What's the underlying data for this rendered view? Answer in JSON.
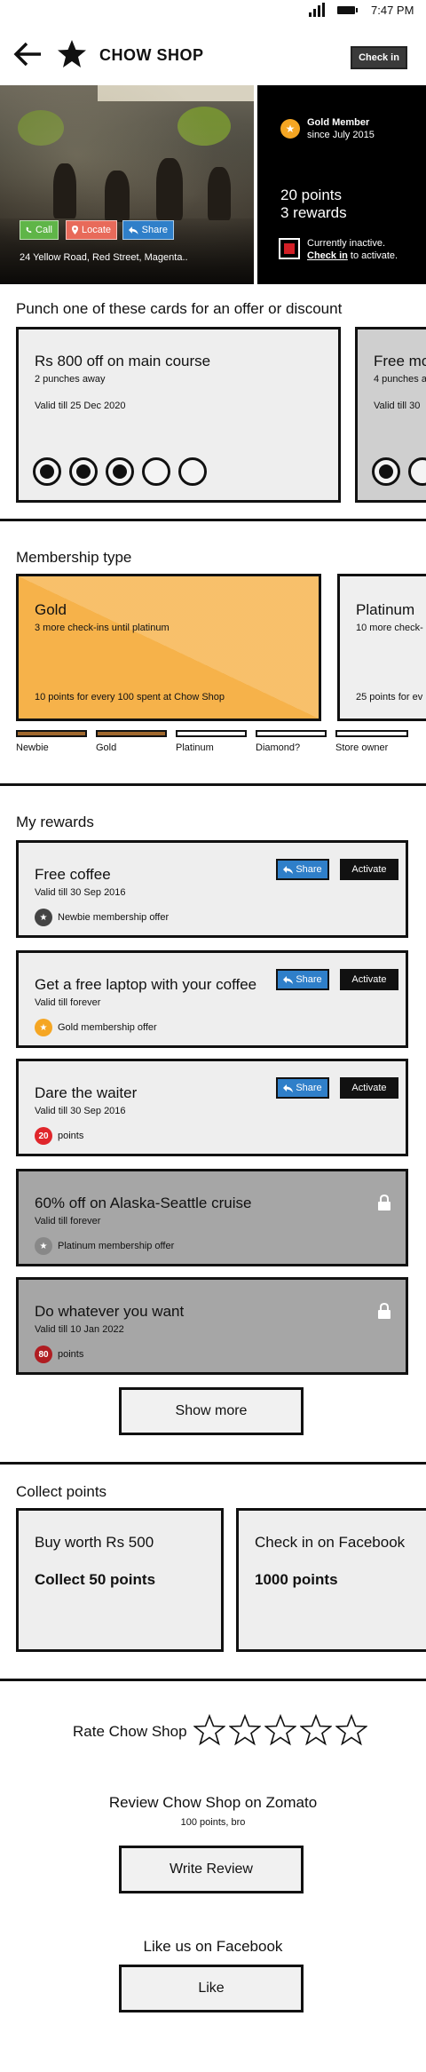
{
  "status_bar": {
    "time": "7:47 PM"
  },
  "header": {
    "title": "CHOW SHOP",
    "checkin_label": "Check in"
  },
  "hero": {
    "actions": {
      "call": "Call",
      "locate": "Locate",
      "share": "Share"
    },
    "address": "24 Yellow Road, Red Street, Magenta..",
    "member_title": "Gold Member",
    "member_since": "since July 2015",
    "points": "20 points",
    "rewards": "3 rewards",
    "inactive_line1": "Currently inactive.",
    "inactive_link": "Check in",
    "inactive_line2_rest": " to activate."
  },
  "punch_section": {
    "title": "Punch one of these cards for an offer or discount",
    "cards": [
      {
        "title": "Rs 800 off on main course",
        "sub": "2 punches away",
        "valid": "Valid till 25 Dec 2020",
        "filled": 3,
        "total": 5
      },
      {
        "title": "Free mo",
        "sub": "4 punches a",
        "valid": "Valid till 30",
        "filled": 1,
        "total": 2
      }
    ]
  },
  "membership": {
    "title": "Membership type",
    "cards": [
      {
        "title": "Gold",
        "sub": "3 more check-ins until platinum",
        "foot": "10 points for every 100 spent at Chow Shop"
      },
      {
        "title": "Platinum",
        "sub": "10 more check-",
        "foot": "25 points for ev"
      }
    ],
    "tiers": [
      "Newbie",
      "Gold",
      "Platinum",
      "Diamond?",
      "Store owner"
    ]
  },
  "rewards": {
    "title": "My rewards",
    "share_label": "Share",
    "activate_label": "Activate",
    "items": [
      {
        "title": "Free coffee",
        "valid": "Valid till 30 Sep 2016",
        "badge": "",
        "offer": "Newbie membership offer"
      },
      {
        "title": "Get a free laptop with your coffee",
        "valid": "Valid till forever",
        "badge": "",
        "offer": "Gold membership offer"
      },
      {
        "title": "Dare the waiter",
        "valid": "Valid till 30 Sep 2016",
        "badge": "20",
        "offer": "points"
      },
      {
        "title": "60% off on Alaska-Seattle cruise",
        "valid": "Valid till forever",
        "badge": "",
        "offer": "Platinum membership offer"
      },
      {
        "title": "Do whatever you want",
        "valid": "Valid till 10 Jan 2022",
        "badge": "80",
        "offer": "points"
      }
    ],
    "show_more": "Show more"
  },
  "collect": {
    "title": "Collect points",
    "cards": [
      {
        "top": "Buy worth Rs 500",
        "bottom": "Collect 50 points"
      },
      {
        "top": "Check in on Facebook",
        "bottom": "1000 points"
      }
    ]
  },
  "rate": {
    "label": "Rate Chow Shop"
  },
  "review": {
    "title": "Review Chow Shop on Zomato",
    "sub": "100 points, bro",
    "button": "Write Review"
  },
  "facebook": {
    "title": "Like us on Facebook",
    "button": "Like"
  },
  "colors": {
    "gold": "#f6b24a",
    "call": "#5fb548",
    "locate": "#e86a5a",
    "share": "#2f7fc9",
    "alert_red": "#d21f26",
    "locked_gray": "#a6a6a6"
  },
  "icons": {
    "back": "arrow-left-icon",
    "logo": "star-icon",
    "badge": "star-badge-icon",
    "lock": "lock-icon",
    "rating": "star-outline-icon"
  }
}
